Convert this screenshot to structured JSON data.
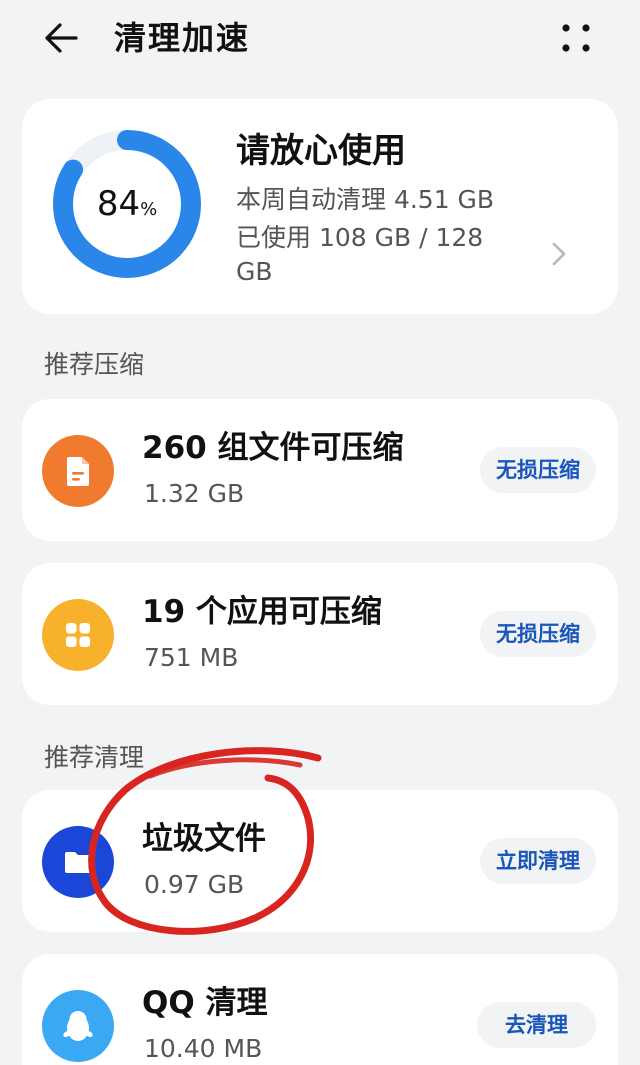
{
  "header": {
    "title": "清理加速"
  },
  "storage": {
    "percent": "84",
    "percent_sign": "%",
    "percent_value": 0.84,
    "status": "请放心使用",
    "weekly_clean": "本周自动清理 4.51 GB",
    "used": "已使用 108 GB / 128 GB"
  },
  "sections": {
    "compress_label": "推荐压缩",
    "clean_label": "推荐清理"
  },
  "items": [
    {
      "title": "260 组文件可压缩",
      "sub": "1.32 GB",
      "button": "无损压缩",
      "icon": "document-icon",
      "color": "#f07b2e"
    },
    {
      "title": "19 个应用可压缩",
      "sub": "751 MB",
      "button": "无损压缩",
      "icon": "apps-grid-icon",
      "color": "#f8b12a"
    },
    {
      "title": "垃圾文件",
      "sub": "0.97 GB",
      "button": "立即清理",
      "icon": "folder-icon",
      "color": "#1b46d8"
    },
    {
      "title": "QQ 清理",
      "sub": "10.40 MB",
      "button": "去清理",
      "icon": "penguin-icon",
      "color": "#3aa8f2"
    }
  ],
  "colors": {
    "ring_blue": "#2b86ea",
    "ring_track": "#eef1f5",
    "button_text": "#1a56b8",
    "annotation_red": "#d8251f"
  }
}
